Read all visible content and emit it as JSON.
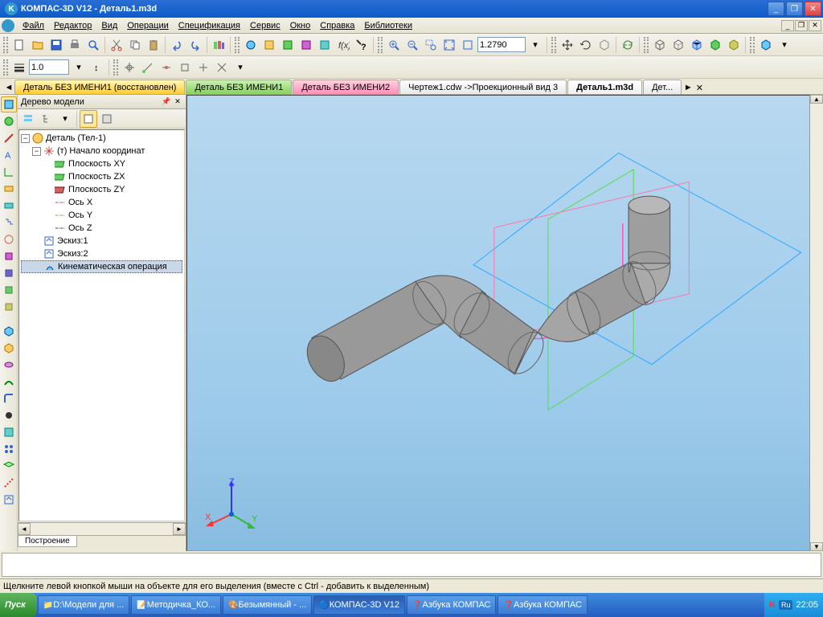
{
  "title": "КОМПАС-3D V12 - Деталь1.m3d",
  "menu": [
    "Файл",
    "Редактор",
    "Вид",
    "Операции",
    "Спецификация",
    "Сервис",
    "Окно",
    "Справка",
    "Библиотеки"
  ],
  "zoom_value": "1.2790",
  "scale_value": "1.0",
  "tabs": [
    {
      "label": "Деталь БЕЗ ИМЕНИ1 (восстановлен)",
      "color": "yellow"
    },
    {
      "label": "Деталь БЕЗ ИМЕНИ1",
      "color": "green"
    },
    {
      "label": "Деталь БЕЗ ИМЕНИ2",
      "color": "pink"
    },
    {
      "label": "Чертеж1.cdw ->Проекционный вид 3",
      "color": "white"
    },
    {
      "label": "Деталь1.m3d",
      "color": "active"
    },
    {
      "label": "Дет...",
      "color": "white"
    }
  ],
  "tree": {
    "title": "Дерево модели",
    "root": "Деталь (Тел-1)",
    "origin": "(т) Начало координат",
    "planes": [
      "Плоскость XY",
      "Плоскость ZX",
      "Плоскость ZY"
    ],
    "axes": [
      "Ось X",
      "Ось Y",
      "Ось Z"
    ],
    "sketches": [
      "Эскиз:1",
      "Эскиз:2"
    ],
    "operation": "Кинематическая операция",
    "bottom_tab": "Построение"
  },
  "axis_labels": {
    "x": "X",
    "y": "Y",
    "z": "Z"
  },
  "status_hint": "Щелкните левой кнопкой мыши на объекте для его выделения (вместе с Ctrl - добавить к выделенным)",
  "taskbar": {
    "start": "Пуск",
    "items": [
      "D:\\Модели для ...",
      "Методичка_КО...",
      "Безымянный - ...",
      "КОМПАС-3D V12",
      "Азбука КОМПАС",
      "Азбука КОМПАС"
    ],
    "lang": "Ru",
    "time": "22:05"
  }
}
